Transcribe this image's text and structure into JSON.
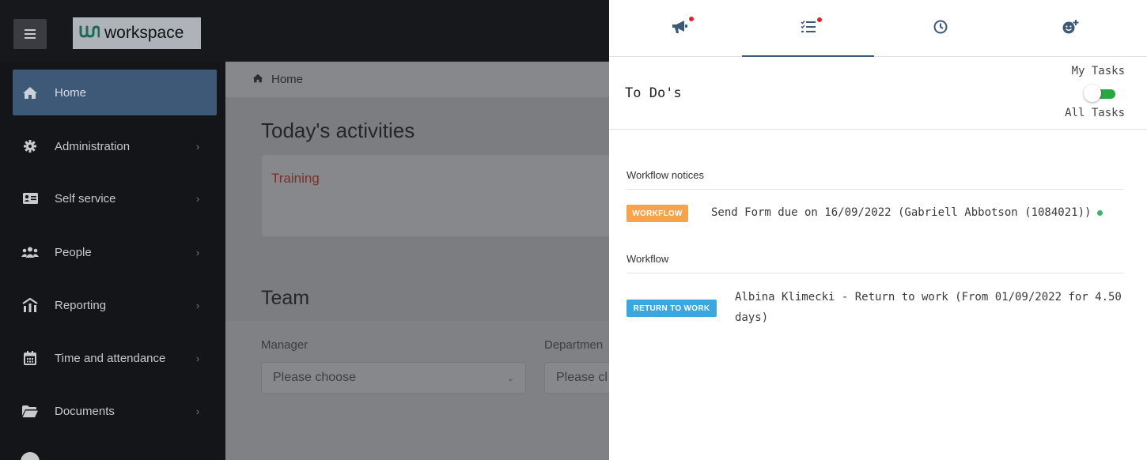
{
  "header": {
    "logo_text": "workspace",
    "logo_mark": "ưŋ",
    "menu_icon": "hamburger-icon"
  },
  "sidebar": {
    "items": [
      {
        "label": "Home",
        "icon": "home-icon",
        "active": true
      },
      {
        "label": "Administration",
        "icon": "gear-icon",
        "chevron": "›"
      },
      {
        "label": "Self service",
        "icon": "id-card-icon",
        "chevron": "›"
      },
      {
        "label": "People",
        "icon": "users-icon",
        "chevron": "›"
      },
      {
        "label": "Reporting",
        "icon": "chart-icon",
        "chevron": "›"
      },
      {
        "label": "Time and attendance",
        "icon": "calendar-icon",
        "chevron": "›"
      },
      {
        "label": "Documents",
        "icon": "folder-icon",
        "chevron": "›"
      }
    ]
  },
  "main": {
    "breadcrumb": "Home",
    "title": "Today's activities",
    "activities": [
      "Training"
    ],
    "team_title": "Team",
    "manager_label": "Manager",
    "manager_value": "Please choose",
    "department_label": "Departmen",
    "department_value": "Please cl"
  },
  "panel": {
    "tabs": [
      {
        "icon": "megaphone-icon",
        "notification": true
      },
      {
        "icon": "tasks-icon",
        "notification": true,
        "active": true
      },
      {
        "icon": "clock-icon"
      },
      {
        "icon": "add-user-icon"
      }
    ],
    "title": "To Do's",
    "toggle_top_label": "My Tasks",
    "toggle_bottom_label": "All Tasks",
    "sections": [
      {
        "label": "Workflow notices",
        "items": [
          {
            "badge": "WORKFLOW",
            "badge_color": "#f6a34b",
            "text": "Send Form due on 16/09/2022 (Gabriell Abbotson (1084021))",
            "status": "green"
          }
        ]
      },
      {
        "label": "Workflow",
        "items": [
          {
            "badge": "RETURN TO WORK",
            "badge_color": "#3aa7e0",
            "text_line1": "Albina Klimecki - Return to work (From 01/09/2022 for 4.50",
            "text_line2": "days)"
          }
        ]
      }
    ]
  },
  "colors": {
    "sidebar_bg": "#141518",
    "active_nav": "#3e5878",
    "toggle_on": "#2aa745",
    "notification_dot": "#e02424"
  }
}
